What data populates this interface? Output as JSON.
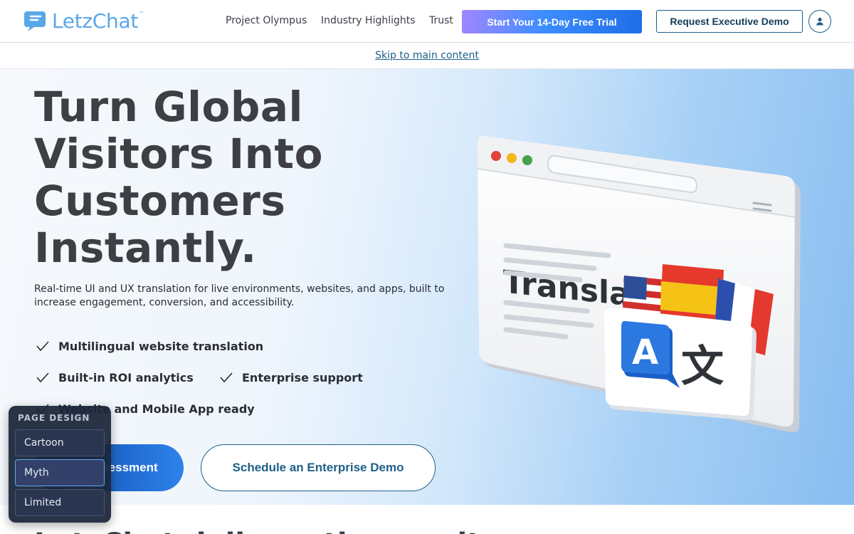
{
  "brand": {
    "name": "LetzChat",
    "tm": "™"
  },
  "nav": {
    "links": [
      "Project Olympus",
      "Industry Highlights",
      "Trust"
    ],
    "trial_button": "Start Your 14-Day Free Trial",
    "exec_demo_button": "Request Executive Demo"
  },
  "skip_link": "Skip to main content",
  "hero": {
    "headline": "Turn Global Visitors Into Customers Instantly.",
    "subtext": "Real-time UI and UX translation for live environments, websites, and apps, built to increase engagement, conversion, and accessibility.",
    "features": [
      "Multilingual website translation",
      "Built-in ROI analytics",
      "Enterprise support",
      "Website and Mobile App ready"
    ],
    "primary_cta": "Run Assessment",
    "secondary_cta": "Schedule an Enterprise Demo",
    "illustration": {
      "title": "Translations",
      "glyph_a": "A",
      "glyph_b": "文"
    }
  },
  "next_section_heading": "LetzChat delivers the results",
  "design_panel": {
    "title": "PAGE DESIGN",
    "options": [
      "Cartoon",
      "Myth",
      "Limited"
    ],
    "selected": "Myth"
  },
  "colors": {
    "brand_blue": "#5aa7e8",
    "navy": "#1d5f8a",
    "panel": "#1c263a"
  }
}
